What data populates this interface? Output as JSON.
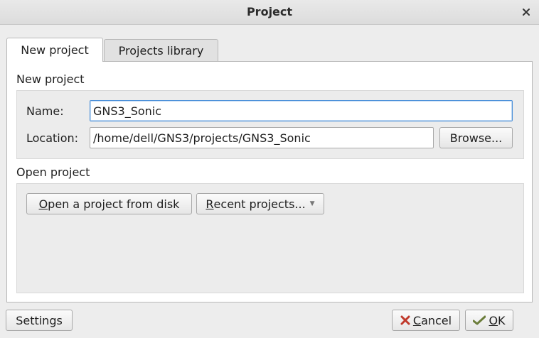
{
  "window": {
    "title": "Project",
    "close_icon": "close-icon"
  },
  "tabs": [
    {
      "label": "New project",
      "active": true
    },
    {
      "label": "Projects library",
      "active": false
    }
  ],
  "new_project": {
    "section_label": "New project",
    "name_label": "Name:",
    "name_value": "GNS3_Sonic",
    "location_label": "Location:",
    "location_value": "/home/dell/GNS3/projects/GNS3_Sonic",
    "browse_label": "Browse..."
  },
  "open_project": {
    "section_label": "Open project",
    "open_disk_mnemonic": "O",
    "open_disk_rest": "pen a project from disk",
    "recent_mnemonic": "R",
    "recent_rest": "ecent projects...",
    "recent_arrow_icon": "dropdown-arrow-icon"
  },
  "footer": {
    "settings_label": "Settings",
    "cancel_icon": "cancel-x-icon",
    "cancel_mnemonic": "C",
    "cancel_rest": "ancel",
    "ok_icon": "ok-check-icon",
    "ok_mnemonic": "O",
    "ok_rest": "K"
  },
  "colors": {
    "focus_border": "#4a90d9",
    "cancel_icon": "#c0392b",
    "ok_icon": "#6b7d3a"
  }
}
